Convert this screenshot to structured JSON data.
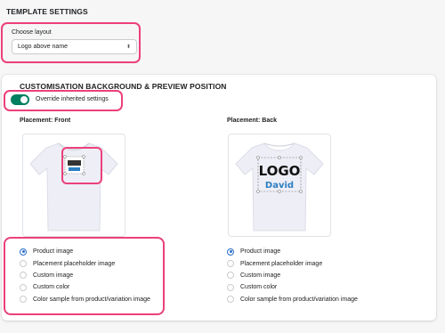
{
  "template_settings": {
    "title": "TEMPLATE SETTINGS",
    "layout_label": "Choose layout",
    "layout_value": "Logo above name"
  },
  "customisation": {
    "title": "CUSTOMISATION BACKGROUND & PREVIEW POSITION",
    "override_label": "Override inherited settings",
    "override_on": true
  },
  "placements": {
    "front": {
      "label": "Placement: Front",
      "options": [
        "Product image",
        "Placement placeholder image",
        "Custom image",
        "Custom color",
        "Color sample from product/variation image"
      ],
      "selected": 0
    },
    "back": {
      "label": "Placement: Back",
      "logo_text": "LOGO",
      "name_text": "David",
      "options": [
        "Product image",
        "Placement placeholder image",
        "Custom image",
        "Custom color",
        "Color sample from product/variation image"
      ],
      "selected": 0
    }
  },
  "colors": {
    "highlight": "#ec407a",
    "toggle_on": "#008060",
    "radio_selected": "#2c6ecb",
    "tshirt": "#eeeef6"
  }
}
